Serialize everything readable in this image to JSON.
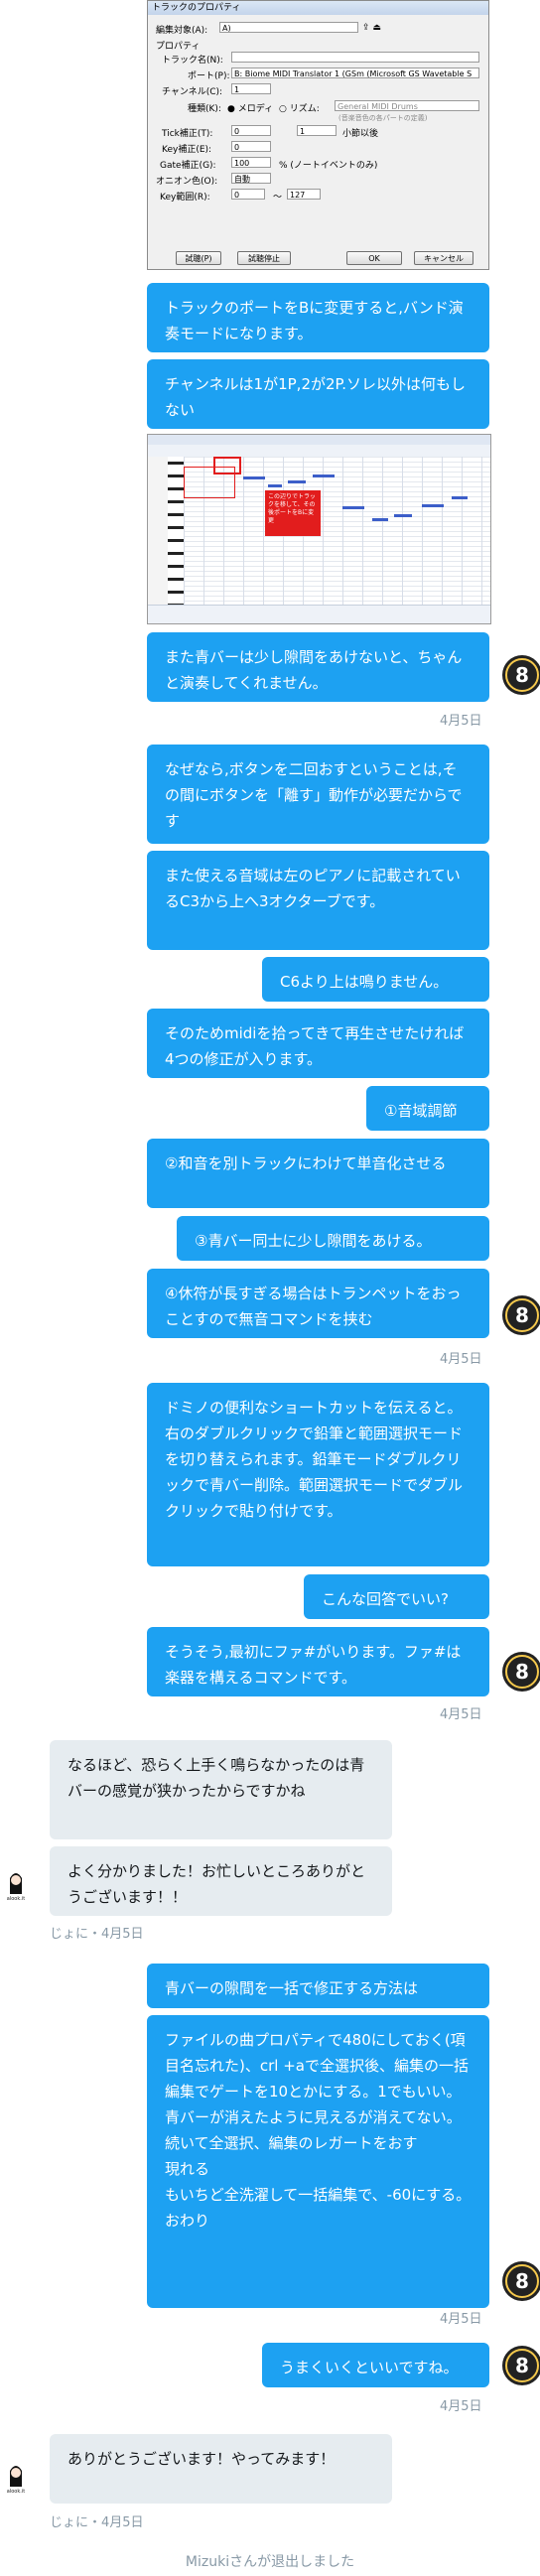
{
  "dialog": {
    "title": "トラックのプロパティ",
    "edit_target_label": "編集対象(A):",
    "edit_target_value": "A)",
    "property_label": "プロパティ",
    "track_name_label": "トラック名(N):",
    "track_name_value": "",
    "port_label": "ポート(P):",
    "port_value": "B: Biome MIDI Translator 1 (GSm (Microsoft GS Wavetable S",
    "channel_label": "チャンネル(C):",
    "channel_value": "1",
    "type_label": "種類(K):",
    "type_melody": "メロディ",
    "type_rhythm": "リズム:",
    "drum_value": "General MIDI Drums",
    "drum_hint": "(音楽音色の各パートの定義)",
    "tick_label": "Tick補正(T):",
    "tick_value": "0",
    "tick_right_value": "1",
    "tick_unit": "小節以後",
    "key_label": "Key補正(E):",
    "key_value": "0",
    "gate_label": "Gate補正(G):",
    "gate_value": "100",
    "gate_unit": "% (ノートイベントのみ)",
    "onkai_label": "オニオン色(O):",
    "onkai_value": "自動",
    "keyrange_label": "Key範囲(R):",
    "keyrange_from": "0",
    "keyrange_sep": "〜",
    "keyrange_to": "127",
    "test_button": "試聴(P)",
    "test_stop_button": "試聴停止",
    "ok_button": "OK",
    "cancel_button": "キャンセル"
  },
  "roll": {
    "annotation": "この辺りでトラックを移して、その後ポートをBに変更"
  },
  "messages": [
    {
      "side": "right",
      "text": "トラックのポートをBに変更すると,バンド演奏モードになります。"
    },
    {
      "side": "right",
      "text": "チャンネルは1が1P,2が2P.ソレ以外は何もしない"
    },
    {
      "side": "right",
      "text": "また青バーは少し隙間をあけないと、ちゃんと演奏してくれません。"
    },
    {
      "side": "right",
      "text": "なぜなら,ボタンを二回おすということは,その間にボタンを「離す」動作が必要だからです"
    },
    {
      "side": "right",
      "text": "また使える音域は左のピアノに記載されているC3から上へ3オクターブです。"
    },
    {
      "side": "right",
      "text": "C6より上は鳴りません。"
    },
    {
      "side": "right",
      "text": "そのためmidiを拾ってきて再生させたければ4つの修正が入ります。"
    },
    {
      "side": "right",
      "text": "①音域調節"
    },
    {
      "side": "right",
      "text": "②和音を別トラックにわけて単音化させる"
    },
    {
      "side": "right",
      "text": "③青バー同士に少し隙間をあける。"
    },
    {
      "side": "right",
      "text": "④休符が長すぎる場合はトランペットをおっことすので無音コマンドを挟む"
    },
    {
      "side": "right",
      "text": "ドミノの便利なショートカットを伝えると。右のダブルクリックで鉛筆と範囲選択モードを切り替えられます。鉛筆モードダブルクリックで青バー削除。範囲選択モードでダブルクリックで貼り付けです。"
    },
    {
      "side": "right",
      "text": "こんな回答でいい?"
    },
    {
      "side": "right",
      "text": "そうそう,最初にファ#がいります。ファ#は楽器を構えるコマンドです。"
    },
    {
      "side": "left",
      "text": "なるほど、恐らく上手く鳴らなかったのは青バーの感覚が狭かったからですかね"
    },
    {
      "side": "left",
      "text": "よく分かりました！お忙しいところありがとうございます！！"
    },
    {
      "side": "right",
      "text": "青バーの隙間を一括で修正する方法は"
    },
    {
      "side": "right",
      "text": "ファイルの曲プロパティで480にしておく(項目名忘れた)、crl +aで全選択後、編集の一括編集でゲートを10とかにする。1でもいい。\n青バーが消えたように見えるが消えてない。\n続いて全選択、編集のレガートをおす\n現れる\nもいちど全洗濯して一括編集で、-60にする。おわり"
    },
    {
      "side": "right",
      "text": "うまくいくといいですね。"
    },
    {
      "side": "left",
      "text": "ありがとうございます！やってみます！"
    }
  ],
  "dates": {
    "d1": "4月5日",
    "d2": "4月5日",
    "d3": "4月5日",
    "d4": "4月5日",
    "d5": "4月5日"
  },
  "left_meta": {
    "meta1": "じょに・4月5日",
    "meta2": "じょに・4月5日"
  },
  "avatar_right_label": "8",
  "avatar_left_label": "alook.it",
  "system_notice": "Mizukiさんが退出しました",
  "colors": {
    "bubble_right": "#1da1f2",
    "bubble_left": "#e6ecf0",
    "date": "#8899a6"
  }
}
